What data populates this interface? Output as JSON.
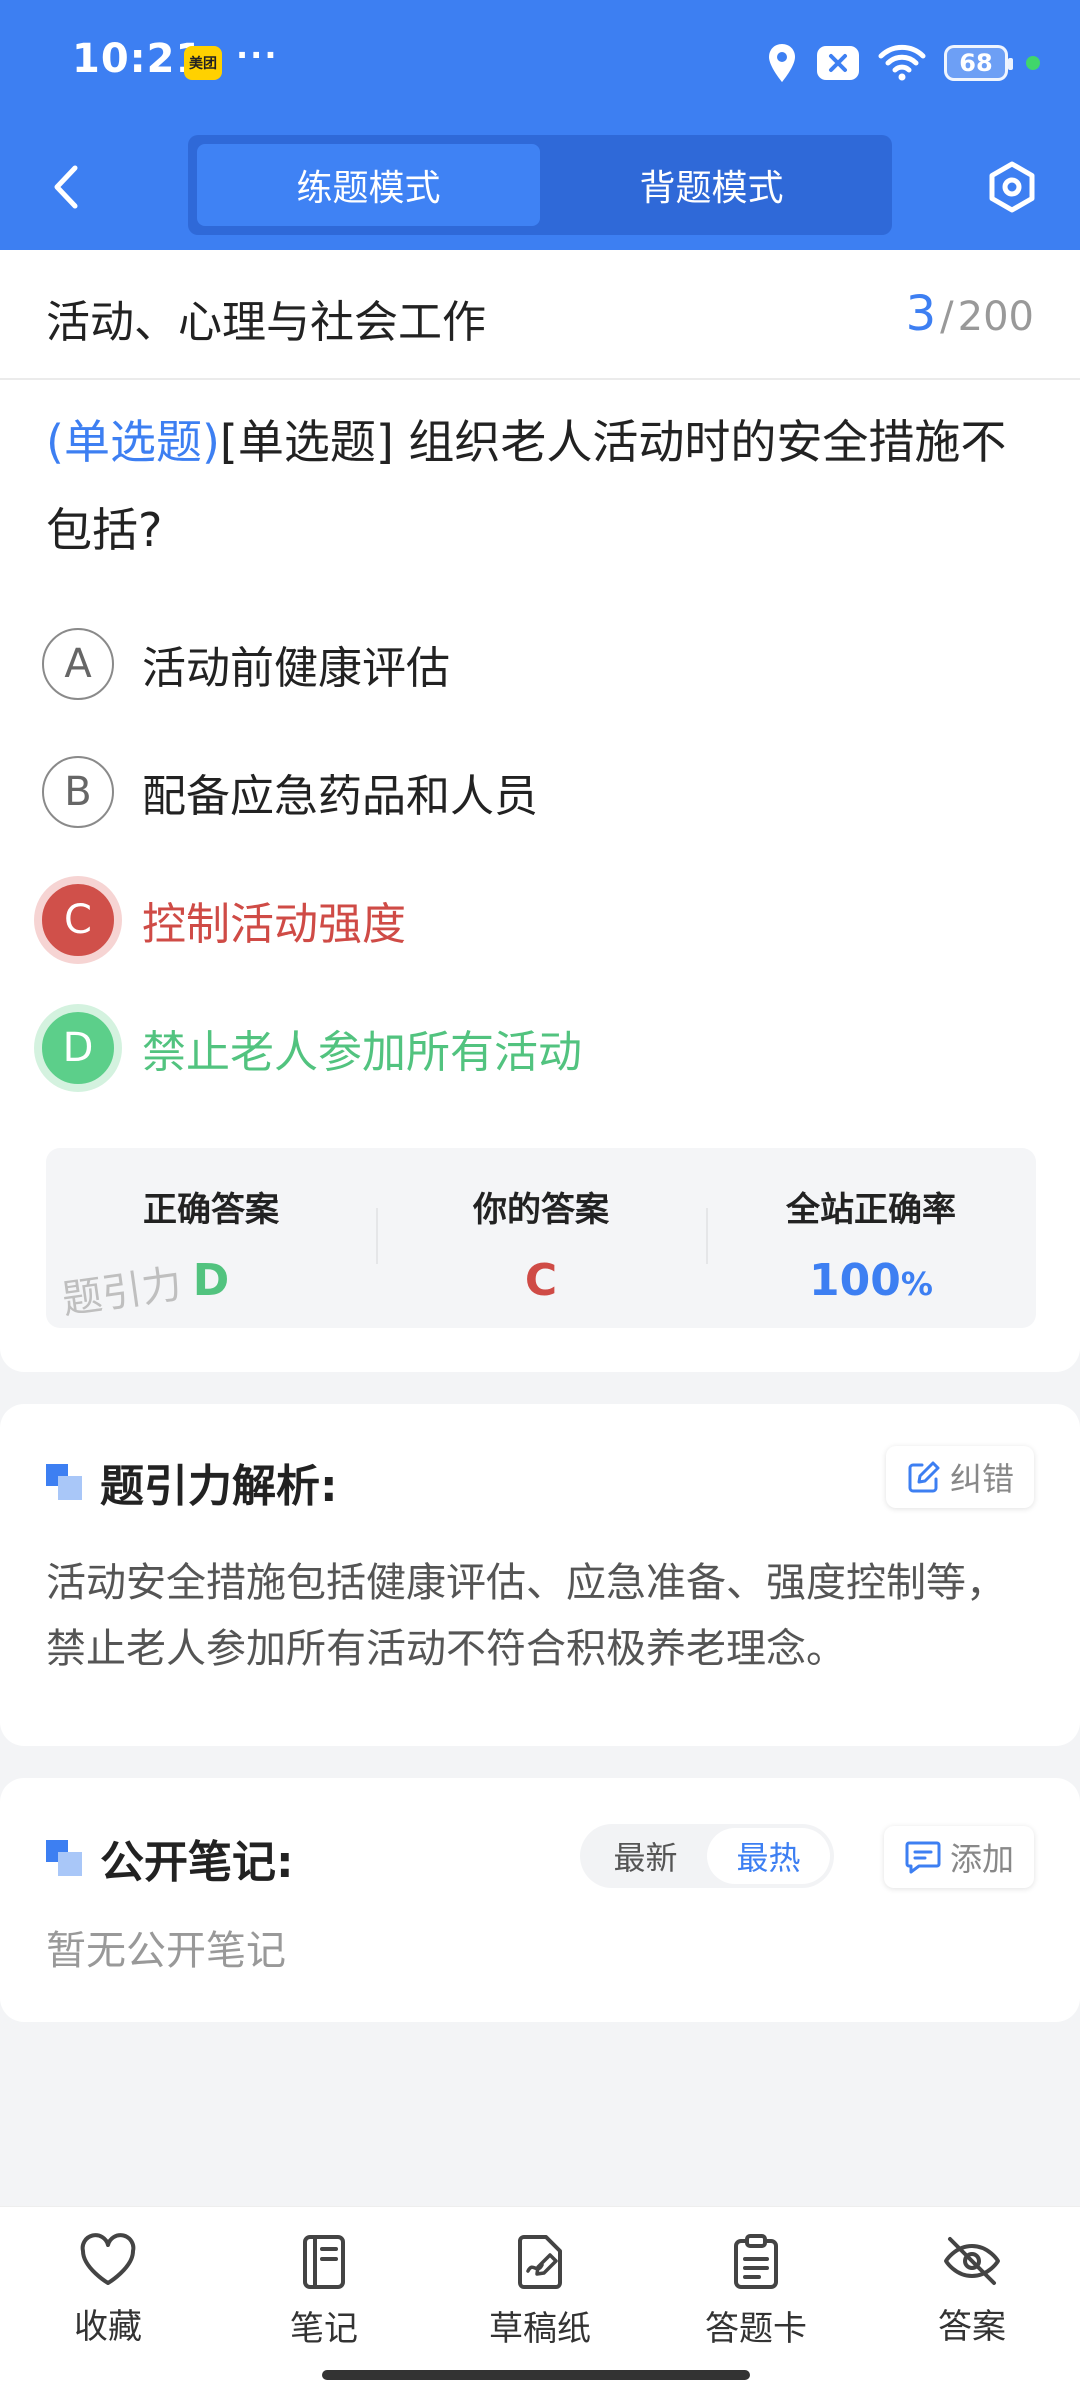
{
  "status_bar": {
    "time": "10:21",
    "app_badge": "美团",
    "more": "···",
    "battery": "68"
  },
  "nav": {
    "modes": [
      "练题模式",
      "背题模式"
    ],
    "active_mode": 0
  },
  "question": {
    "category": "活动、心理与社会工作",
    "current": "3",
    "separator": "/",
    "total": "200",
    "type_tag": "(单选题)",
    "text": "[单选题] 组织老人活动时的安全措施不包括?",
    "options": [
      {
        "letter": "A",
        "text": "活动前健康评估",
        "state": "normal"
      },
      {
        "letter": "B",
        "text": "配备应急药品和人员",
        "state": "normal"
      },
      {
        "letter": "C",
        "text": "控制活动强度",
        "state": "wrong"
      },
      {
        "letter": "D",
        "text": "禁止老人参加所有活动",
        "state": "correct"
      }
    ]
  },
  "stats": {
    "correct_label": "正确答案",
    "correct_value": "D",
    "yours_label": "你的答案",
    "yours_value": "C",
    "rate_label": "全站正确率",
    "rate_value": "100",
    "rate_unit": "%",
    "watermark": "题引力"
  },
  "analysis": {
    "title": "题引力解析:",
    "report_label": "纠错",
    "text": "活动安全措施包括健康评估、应急准备、强度控制等，禁止老人参加所有活动不符合积极养老理念。"
  },
  "notes": {
    "title": "公开笔记:",
    "sort_options": [
      "最新",
      "最热"
    ],
    "active_sort": 1,
    "add_label": "添加",
    "empty_text": "暂无公开笔记"
  },
  "bottom_nav": [
    {
      "label": "收藏",
      "icon": "heart-icon"
    },
    {
      "label": "笔记",
      "icon": "notebook-icon"
    },
    {
      "label": "草稿纸",
      "icon": "draft-paper-icon"
    },
    {
      "label": "答题卡",
      "icon": "answer-card-icon"
    },
    {
      "label": "答案",
      "icon": "eye-off-icon"
    }
  ],
  "colors": {
    "primary": "#3d7ff2",
    "wrong": "#cf4b46",
    "correct": "#52c37f"
  }
}
